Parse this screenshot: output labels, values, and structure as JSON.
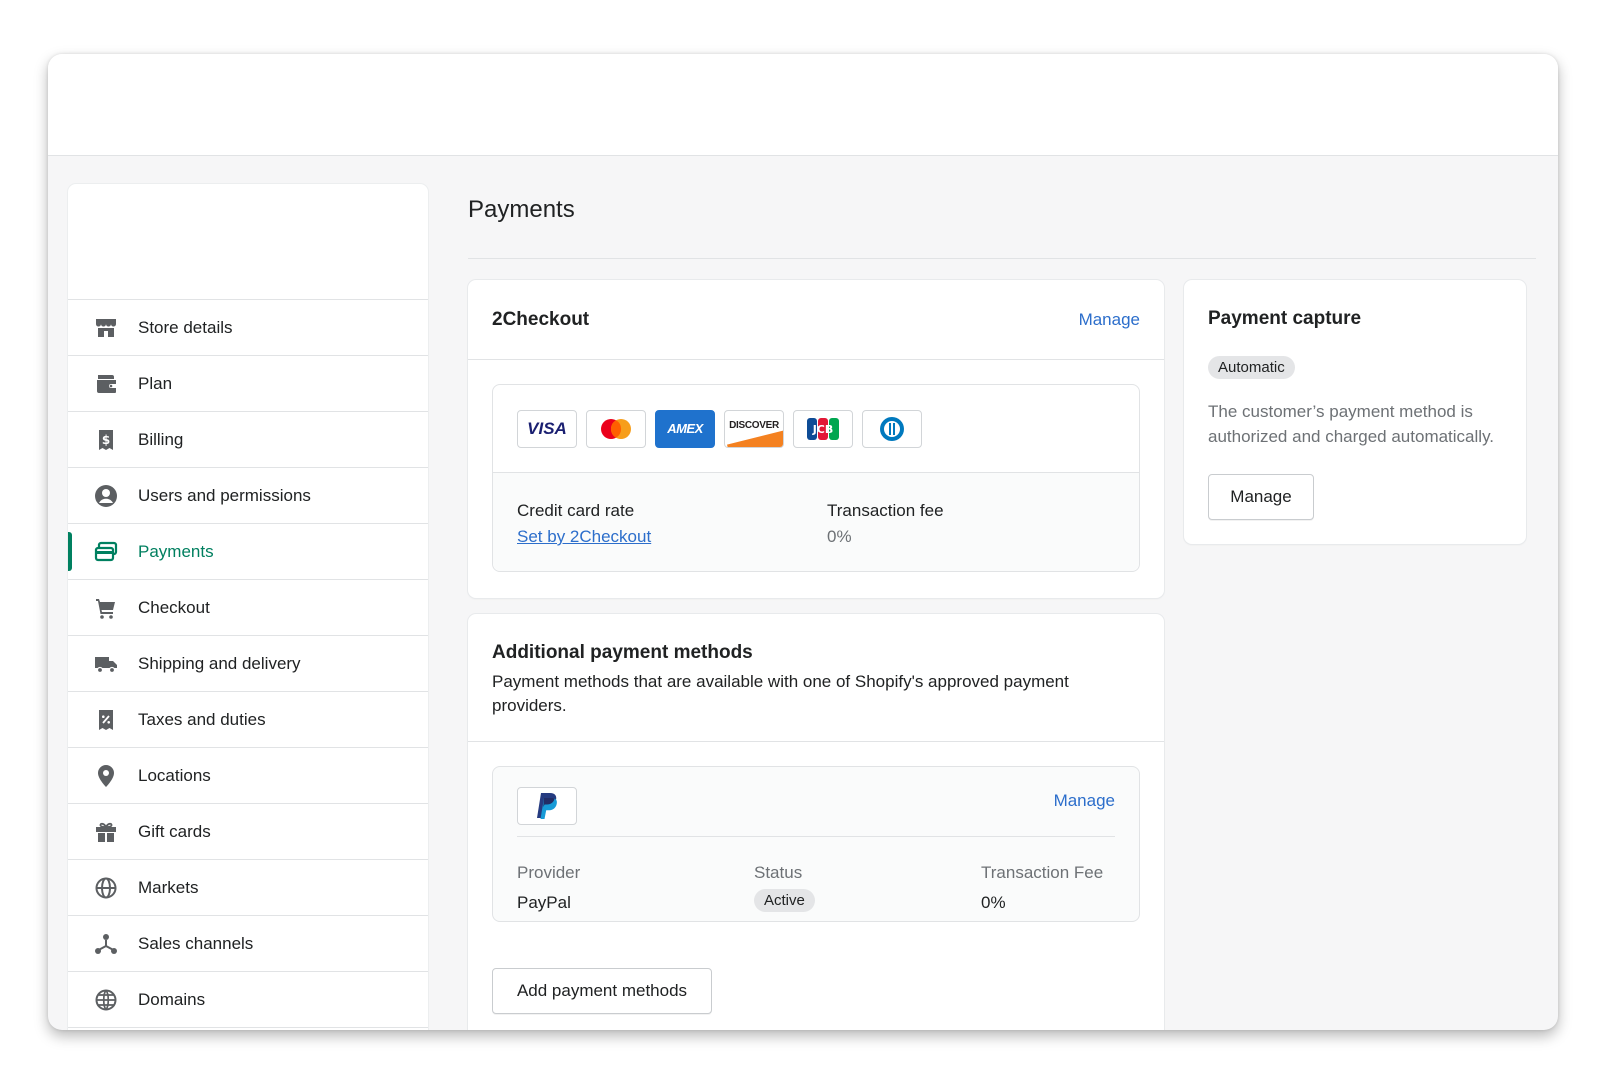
{
  "sidebar": {
    "items": [
      {
        "label": "Store details",
        "icon": "store-icon"
      },
      {
        "label": "Plan",
        "icon": "plan-icon"
      },
      {
        "label": "Billing",
        "icon": "billing-icon"
      },
      {
        "label": "Users and permissions",
        "icon": "user-icon"
      },
      {
        "label": "Payments",
        "icon": "payments-icon",
        "active": true
      },
      {
        "label": "Checkout",
        "icon": "cart-icon"
      },
      {
        "label": "Shipping and delivery",
        "icon": "truck-icon"
      },
      {
        "label": "Taxes and duties",
        "icon": "tax-icon"
      },
      {
        "label": "Locations",
        "icon": "location-pin-icon"
      },
      {
        "label": "Gift cards",
        "icon": "gift-icon"
      },
      {
        "label": "Markets",
        "icon": "markets-globe-icon"
      },
      {
        "label": "Sales channels",
        "icon": "sales-channels-icon"
      },
      {
        "label": "Domains",
        "icon": "domains-globe-icon"
      }
    ]
  },
  "page": {
    "title": "Payments"
  },
  "provider_card": {
    "title": "2Checkout",
    "manage_label": "Manage",
    "card_brands": [
      "VISA",
      "Mastercard",
      "AMEX",
      "DISCOVER",
      "JCB",
      "Diners Club"
    ],
    "credit_card_rate_label": "Credit card rate",
    "credit_card_rate_value": "Set by 2Checkout",
    "transaction_fee_label": "Transaction fee",
    "transaction_fee_value": "0%"
  },
  "additional": {
    "title": "Additional payment methods",
    "description": "Payment methods that are available with one of Shopify's approved payment providers.",
    "paypal": {
      "logo": "paypal-logo",
      "manage_label": "Manage",
      "provider_label": "Provider",
      "provider_value": "PayPal",
      "status_label": "Status",
      "status_value": "Active",
      "fee_label": "Transaction Fee",
      "fee_value": "0%"
    },
    "add_button_label": "Add payment methods"
  },
  "capture": {
    "title": "Payment capture",
    "badge": "Automatic",
    "description": "The customer’s payment method is authorized and charged automatically.",
    "manage_label": "Manage"
  },
  "colors": {
    "accent_green": "#008060",
    "link_blue": "#2c6ecb",
    "page_bg": "#f6f6f7"
  }
}
